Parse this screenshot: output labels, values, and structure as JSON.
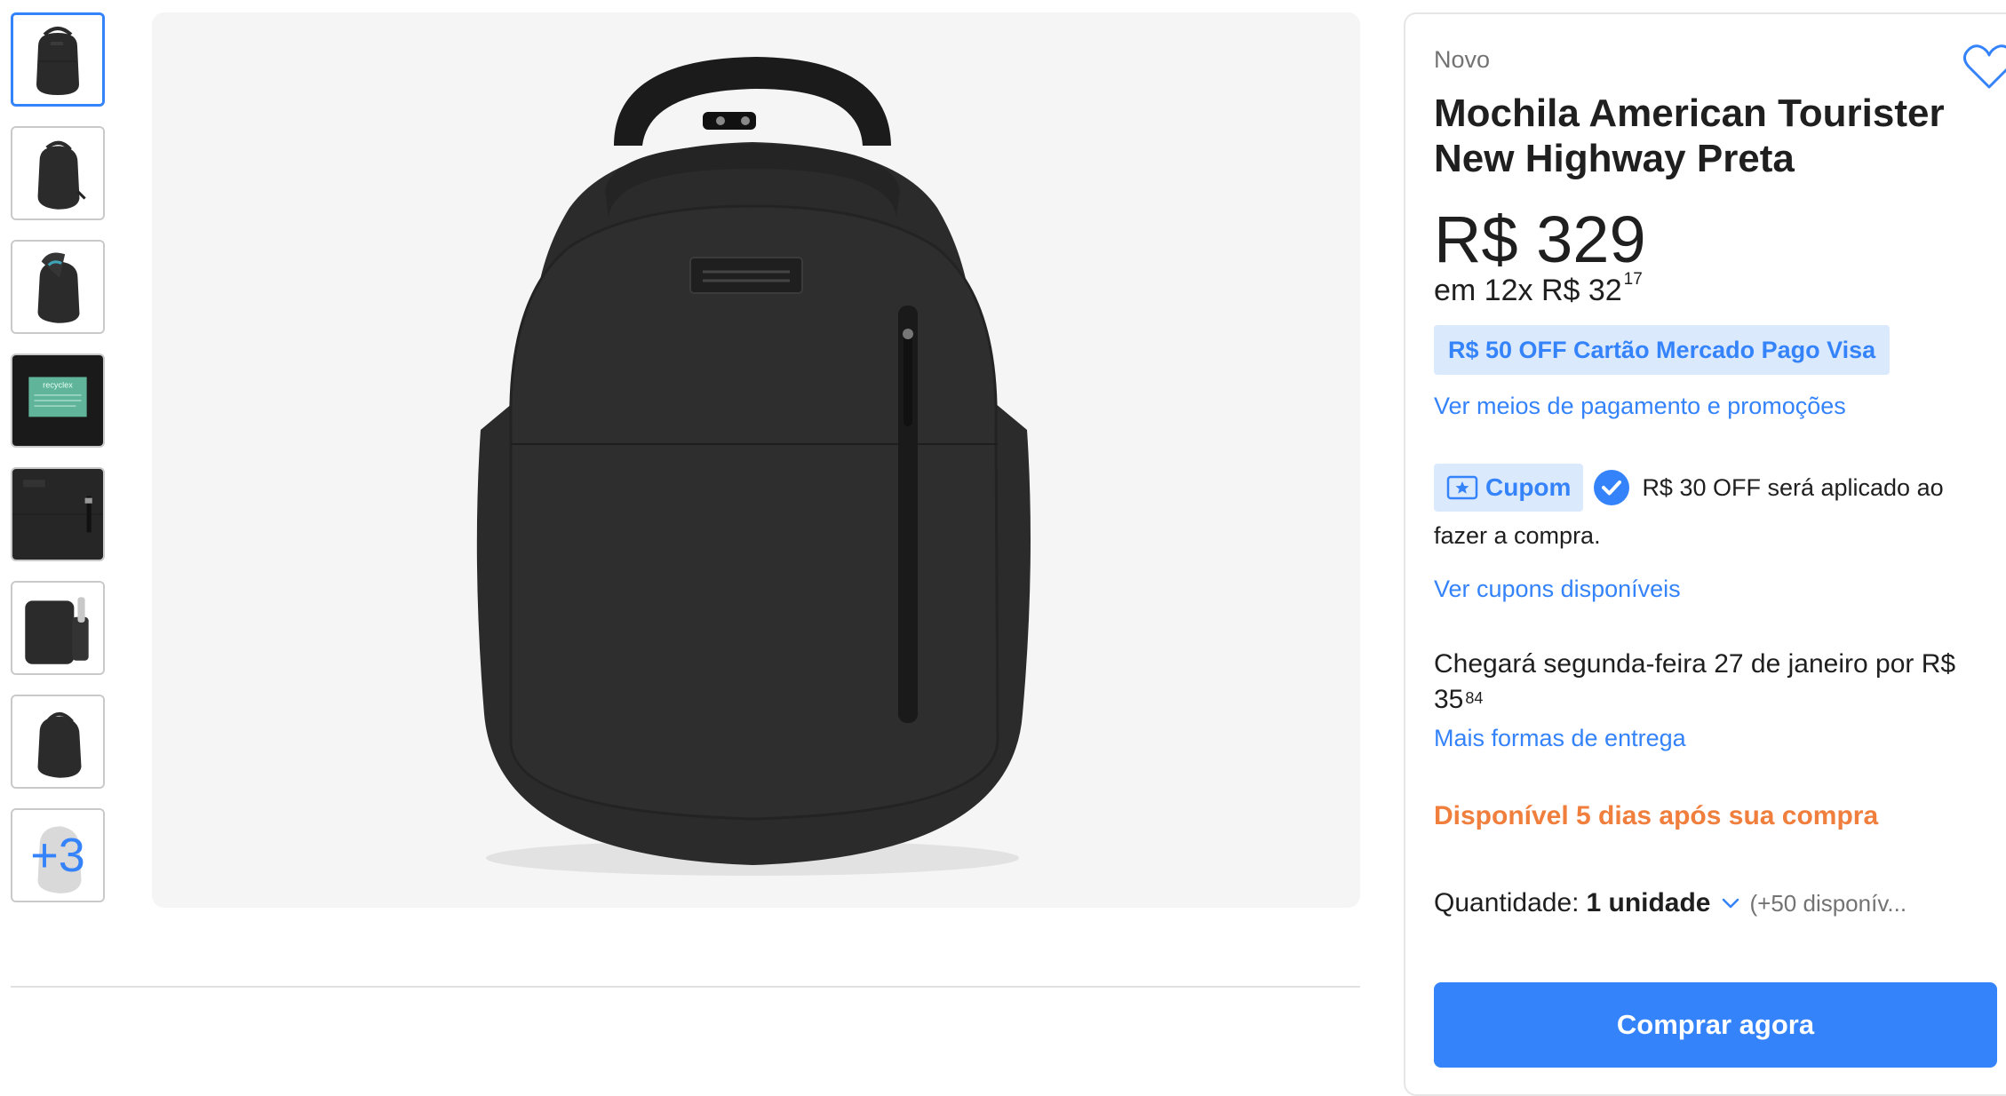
{
  "gallery": {
    "thumbnails": [
      {
        "icon": "backpack-front-thumbnail",
        "active": true
      },
      {
        "icon": "backpack-angle-thumbnail",
        "active": false
      },
      {
        "icon": "backpack-open-thumbnail",
        "active": false
      },
      {
        "icon": "recyclex-label-thumbnail",
        "active": false,
        "label": "recyclex"
      },
      {
        "icon": "backpack-detail-thumbnail",
        "active": false
      },
      {
        "icon": "backpack-side-bottle-thumbnail",
        "active": false
      },
      {
        "icon": "backpack-angle2-thumbnail",
        "active": false
      }
    ],
    "more_label": "+3",
    "main_image_icon": "backpack-main-image"
  },
  "product": {
    "condition": "Novo",
    "title": "Mochila American Tourister New Highway Preta",
    "price": "R$ 329",
    "installments_prefix": "em 12x R$ 32",
    "installments_cents": "17",
    "promo_badge": "R$ 50 OFF Cartão Mercado Pago Visa",
    "payment_link": "Ver meios de pagamento e promoções",
    "coupon_badge": "Cupom",
    "coupon_text": "R$ 30 OFF será aplicado ao fazer a compra.",
    "coupons_link": "Ver cupons disponíveis",
    "delivery_text": "Chegará segunda-feira 27 de janeiro por R$ 35",
    "delivery_cents": "84",
    "delivery_link": "Mais formas de entrega",
    "availability": "Disponível 5 dias após sua compra",
    "quantity_label": "Quantidade:",
    "quantity_value": "1 unidade",
    "stock": "(+50 disponív...",
    "buy_button": "Comprar agora"
  },
  "colors": {
    "accent": "#3483fa",
    "accent_light": "#dbe9fd",
    "availability": "#f07e3c"
  }
}
